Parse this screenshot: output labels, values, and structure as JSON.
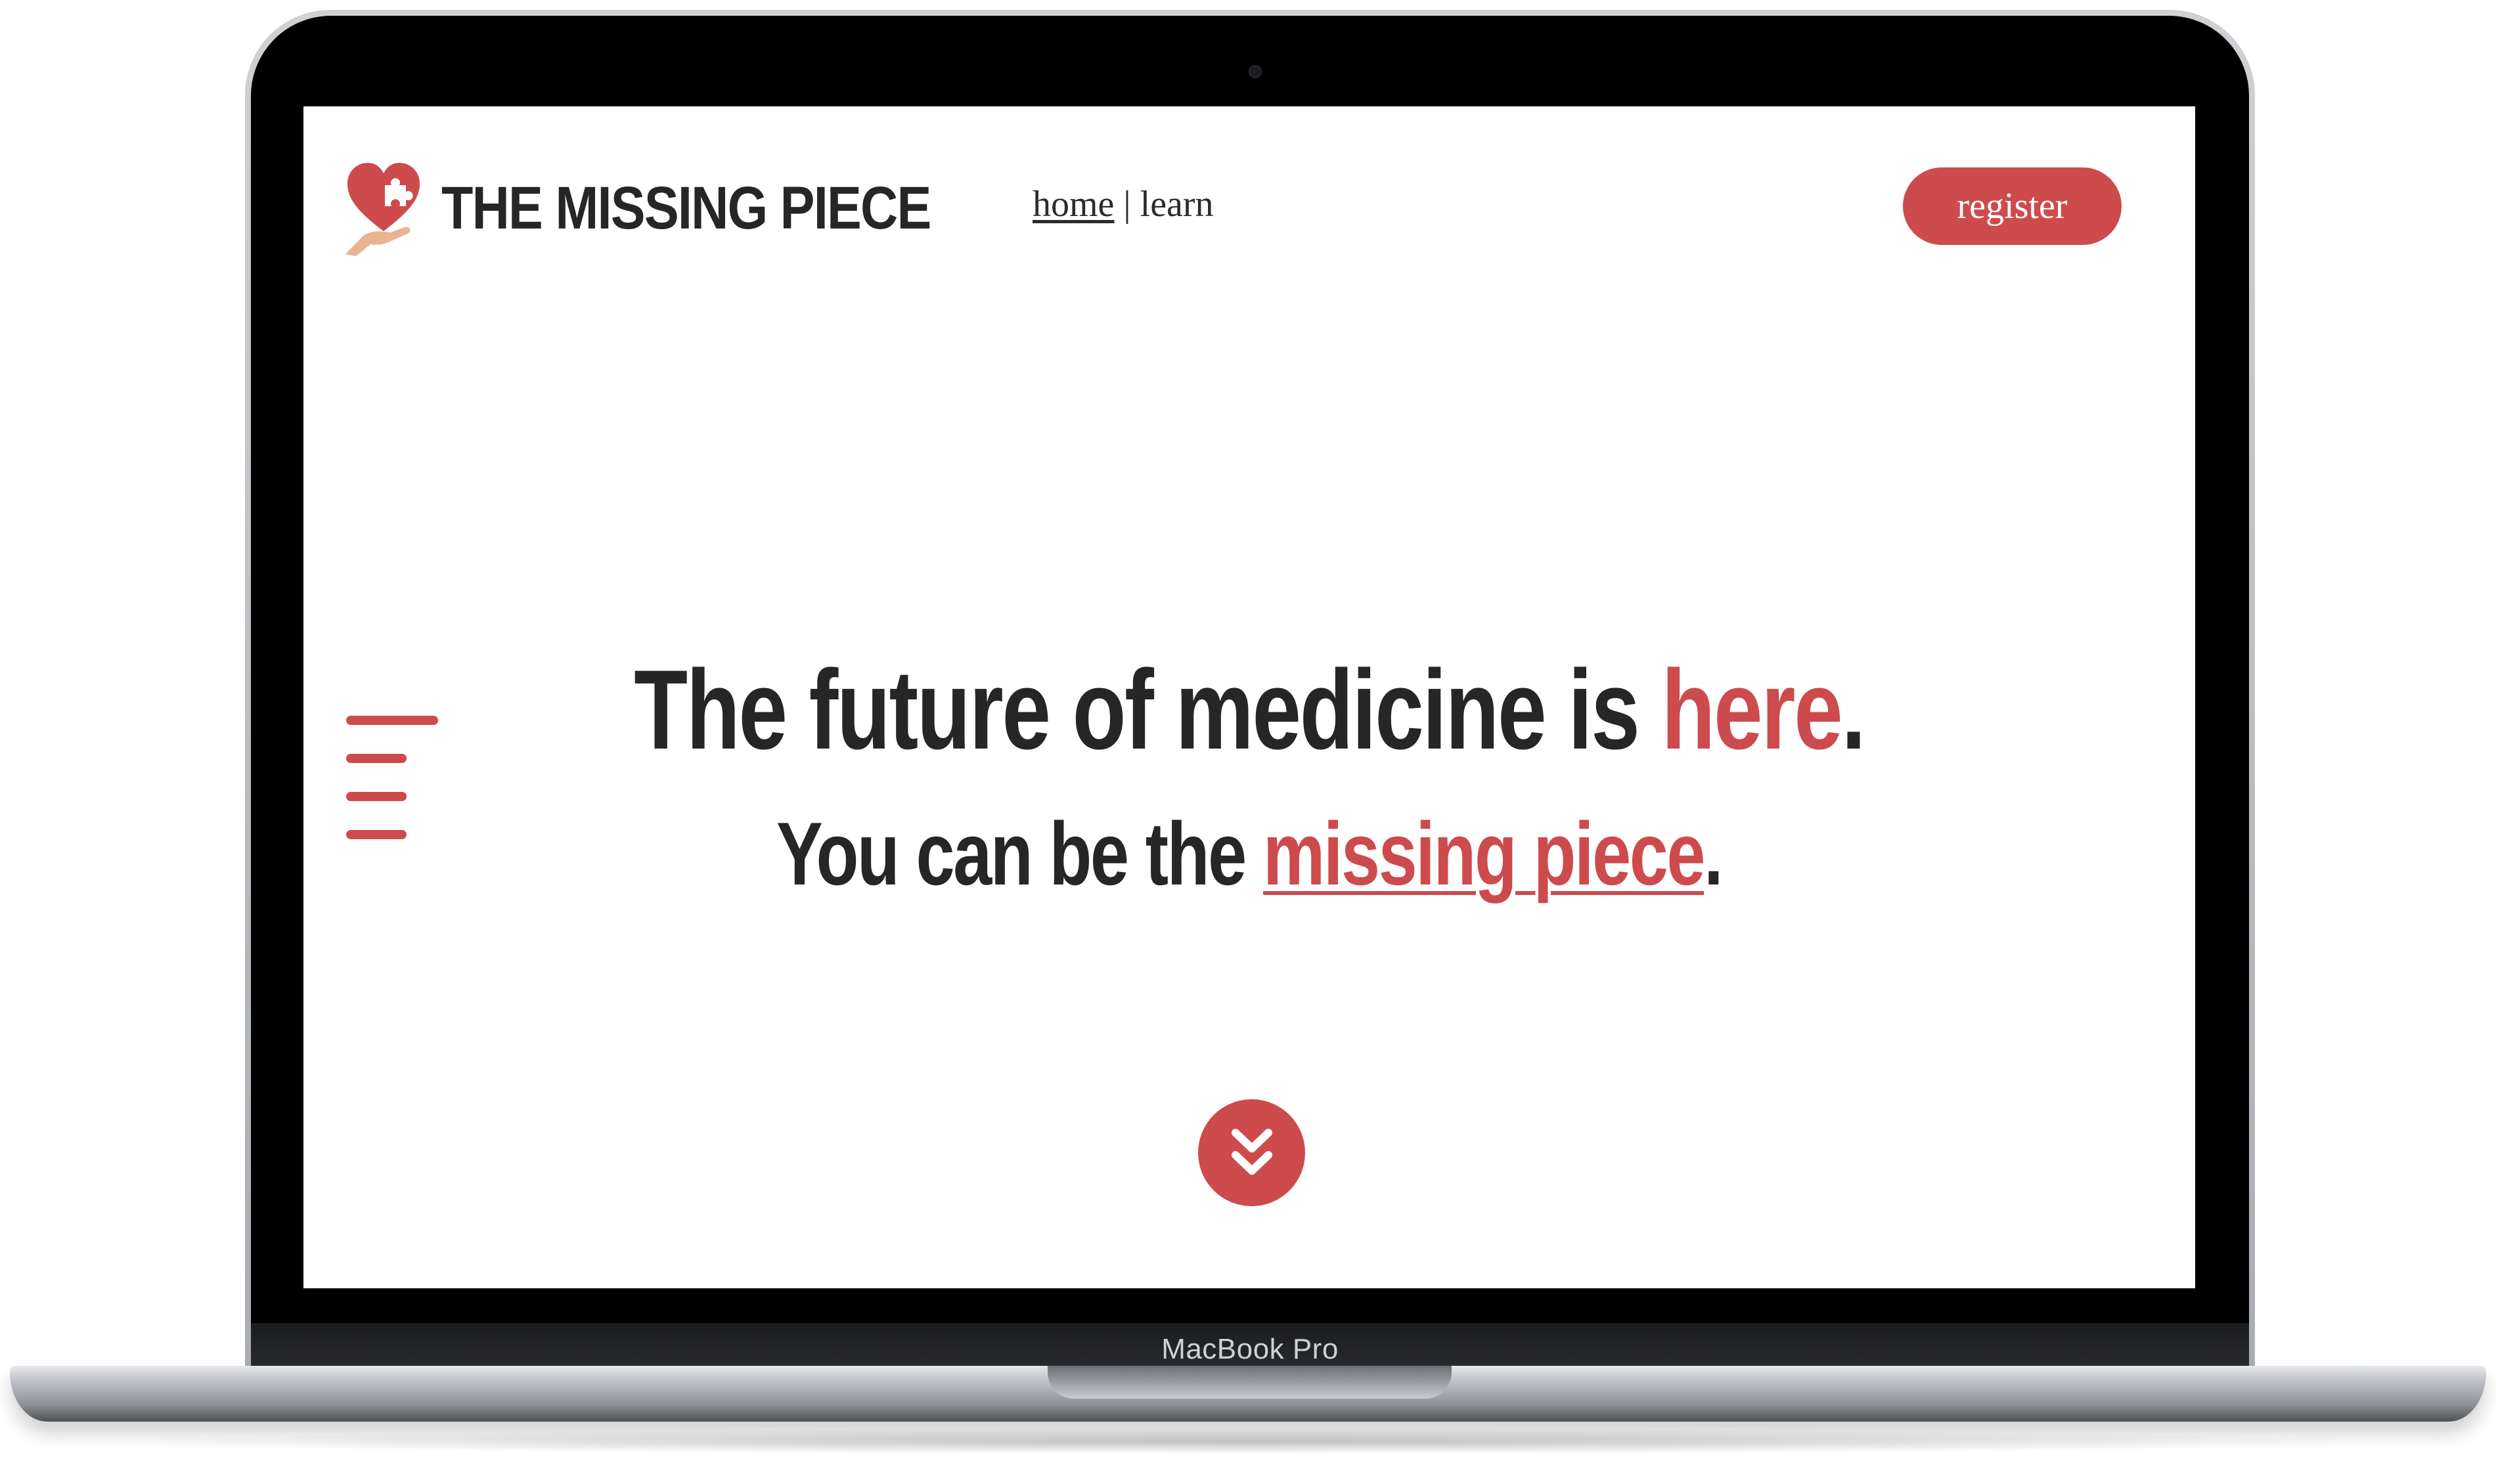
{
  "device": {
    "label": "MacBook Pro"
  },
  "brand": {
    "name": "THE MISSING PIECE",
    "logo_icon": "heart-puzzle-hand-icon",
    "accent_color": "#cd4b4d",
    "text_color": "#262626"
  },
  "nav": {
    "items": [
      {
        "label": "home",
        "active": true
      },
      {
        "label": "learn",
        "active": false
      }
    ],
    "separator": "|"
  },
  "header": {
    "register_label": "register"
  },
  "hero": {
    "line1_prefix": "The future of medicine is ",
    "line1_accent": "here",
    "line1_suffix": ".",
    "line2_prefix": "You can be the ",
    "line2_link": "missing piece",
    "line2_suffix": "."
  },
  "icons": {
    "menu": "hamburger-menu-icon",
    "scroll": "double-chevron-down-icon"
  }
}
